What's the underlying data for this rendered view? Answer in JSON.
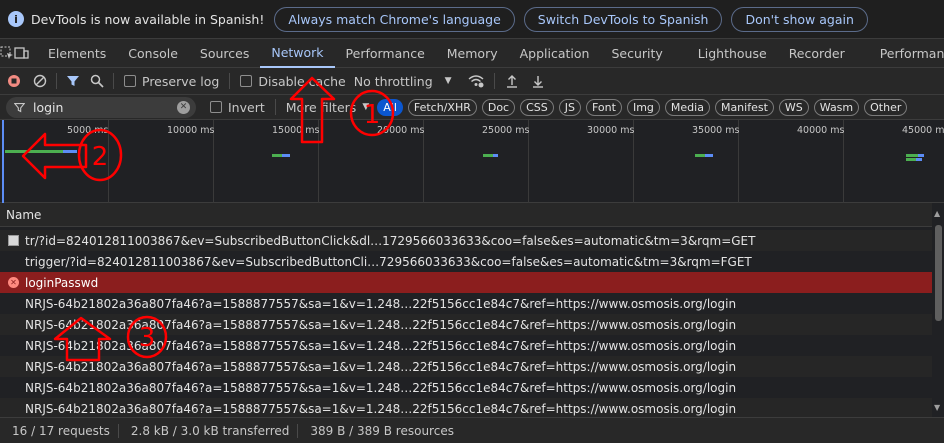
{
  "infobar": {
    "message": "DevTools is now available in Spanish!",
    "buttons": [
      "Always match Chrome's language",
      "Switch DevTools to Spanish",
      "Don't show again"
    ]
  },
  "tabs": [
    "Elements",
    "Console",
    "Sources",
    "Network",
    "Performance",
    "Memory",
    "Application",
    "Security",
    "Lighthouse",
    "Recorder",
    "Performance in"
  ],
  "active_tab": "Network",
  "toolbar": {
    "preserve_log": "Preserve log",
    "disable_cache": "Disable cache",
    "throttling": "No throttling"
  },
  "filter": {
    "search_value": "login",
    "invert": "Invert",
    "more_filters": "More filters",
    "chips": [
      "All",
      "Fetch/XHR",
      "Doc",
      "CSS",
      "JS",
      "Font",
      "Img",
      "Media",
      "Manifest",
      "WS",
      "Wasm",
      "Other"
    ]
  },
  "overview": {
    "ticks": [
      "5000 ms",
      "10000 ms",
      "15000 ms",
      "20000 ms",
      "25000 ms",
      "30000 ms",
      "35000 ms",
      "40000 ms",
      "45000 ms"
    ]
  },
  "table": {
    "column": "Name",
    "rows": [
      {
        "name": "tr/?id=824012811003867&ev=SubscribedButtonClick&dl…1729566033633&coo=false&es=automatic&tm=3&rqm=GET",
        "type": "doc"
      },
      {
        "name": "trigger/?id=824012811003867&ev=SubscribedButtonCli…729566033633&coo=false&es=automatic&tm=3&rqm=FGET",
        "type": "none"
      },
      {
        "name": "loginPasswd",
        "type": "error"
      },
      {
        "name": "NRJS-64b21802a36a807fa46?a=1588877557&sa=1&v=1.248…22f5156cc1e84c7&ref=https://www.osmosis.org/login",
        "type": "none"
      },
      {
        "name": "NRJS-64b21802a36a807fa46?a=1588877557&sa=1&v=1.248…22f5156cc1e84c7&ref=https://www.osmosis.org/login",
        "type": "none"
      },
      {
        "name": "NRJS-64b21802a36a807fa46?a=1588877557&sa=1&v=1.248…22f5156cc1e84c7&ref=https://www.osmosis.org/login",
        "type": "none"
      },
      {
        "name": "NRJS-64b21802a36a807fa46?a=1588877557&sa=1&v=1.248…22f5156cc1e84c7&ref=https://www.osmosis.org/login",
        "type": "none"
      },
      {
        "name": "NRJS-64b21802a36a807fa46?a=1588877557&sa=1&v=1.248…22f5156cc1e84c7&ref=https://www.osmosis.org/login",
        "type": "none"
      },
      {
        "name": "NRJS-64b21802a36a807fa46?a=1588877557&sa=1&v=1.248…22f5156cc1e84c7&ref=https://www.osmosis.org/login",
        "type": "none"
      }
    ]
  },
  "status": {
    "requests": "16 / 17 requests",
    "transferred": "2.8 kB / 3.0 kB transferred",
    "resources": "389 B / 389 B resources"
  },
  "annotations": [
    "1",
    "2",
    "3"
  ],
  "colors": {
    "accent": "#a8c7fa",
    "error_row": "#8b1e1e",
    "annotation": "#ff0000"
  }
}
